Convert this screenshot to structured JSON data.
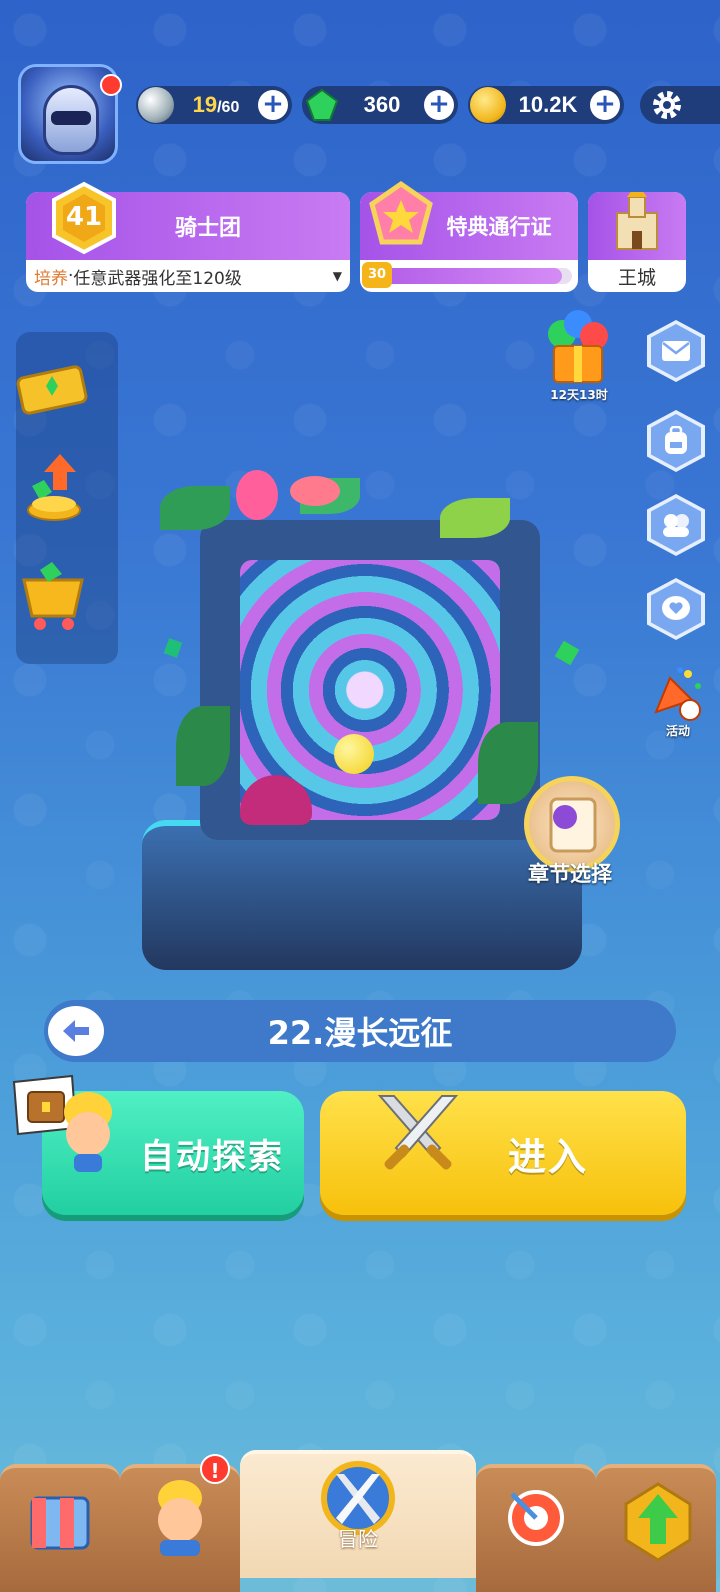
{
  "top_bar": {
    "energy": {
      "current": "19",
      "max": "/60",
      "icon": "pearl-icon"
    },
    "gems": {
      "value": "360",
      "icon": "emerald-icon"
    },
    "coins": {
      "value": "10.2K",
      "icon": "coin-icon"
    },
    "plus_label": "+"
  },
  "guild": {
    "level": "41",
    "title": "骑士团",
    "task_prefix": "培养",
    "task_sep": " · ",
    "task_text": "任意武器强化至120级"
  },
  "battle_pass": {
    "title": "特典通行证",
    "level": "30",
    "progress": 0.95
  },
  "castle": {
    "label": "王城"
  },
  "gift": {
    "timer": "12天13时"
  },
  "events": {
    "label": "活动"
  },
  "chapter_select": {
    "label": "章节选择"
  },
  "stage": {
    "title": "22.漫长远征"
  },
  "actions": {
    "auto_explore": "自动探索",
    "enter": "进入"
  },
  "bottom_nav": {
    "adventure_label": "冒险",
    "hero_badge": "!"
  },
  "colors": {
    "accent_purple": "#a553e8",
    "teal": "#22cfa0",
    "gold": "#f7c10c"
  }
}
